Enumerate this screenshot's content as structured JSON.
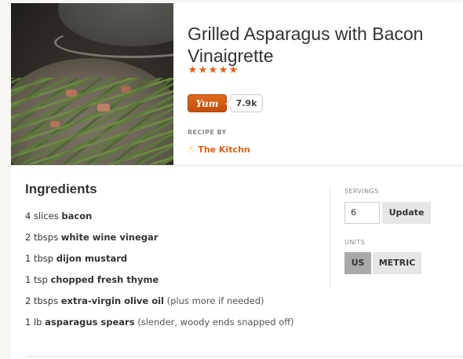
{
  "recipe": {
    "title": "Grilled Asparagus with Bacon Vinaigrette",
    "rating_stars": 5,
    "star_glyph": "★",
    "yum_label": "Yum",
    "yum_count": "7.9k",
    "recipe_by_label": "RECIPE BY",
    "source_name": "The Kitchn",
    "source_icon": "pointing-hand-icon"
  },
  "ingredients": {
    "heading": "Ingredients",
    "items": [
      {
        "qty": "4 slices",
        "name": "bacon",
        "note": ""
      },
      {
        "qty": "2 tbsps",
        "name": "white wine vinegar",
        "note": ""
      },
      {
        "qty": "1 tbsp",
        "name": "dijon mustard",
        "note": ""
      },
      {
        "qty": "1 tsp",
        "name": "chopped fresh thyme",
        "note": ""
      },
      {
        "qty": "2 tbsps",
        "name": "extra-virgin olive oil",
        "note": "(plus more if needed)"
      },
      {
        "qty": "1 lb",
        "name": "asparagus spears",
        "note": "(slender, woody ends snapped off)"
      }
    ]
  },
  "controls": {
    "servings_label": "SERVINGS",
    "servings_value": "6",
    "update_label": "Update",
    "units_label": "UNITS",
    "unit_us": "US",
    "unit_metric": "METRIC",
    "selected_unit": "US"
  },
  "colors": {
    "accent": "#e55d13",
    "yum_button": "#d35400",
    "unit_selected_bg": "#a9a9a9",
    "button_bg": "#e6e6e6"
  }
}
